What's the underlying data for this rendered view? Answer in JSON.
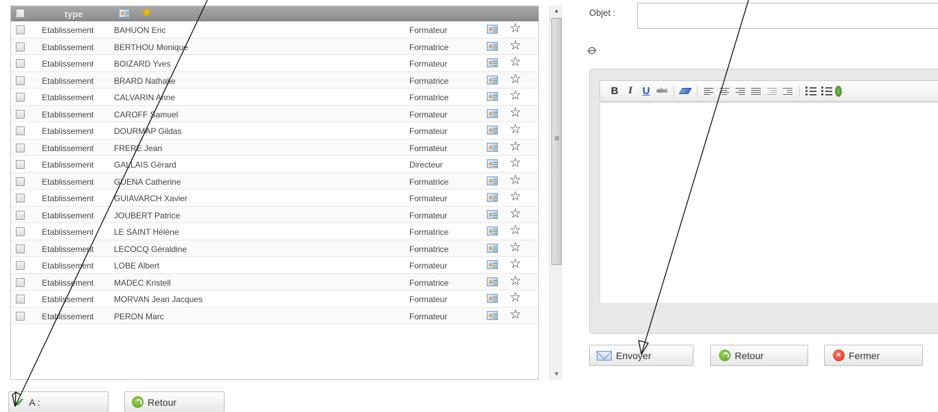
{
  "list": {
    "header_type": "type",
    "rows": [
      {
        "category": "Etablissement",
        "name": "BAHUON Eric",
        "role": "Formateur"
      },
      {
        "category": "Etablissement",
        "name": "BERTHOU Monique",
        "role": "Formatrice"
      },
      {
        "category": "Etablissement",
        "name": "BOIZARD Yves",
        "role": "Formateur"
      },
      {
        "category": "Etablissement",
        "name": "BRARD Nathalie",
        "role": "Formatrice"
      },
      {
        "category": "Etablissement",
        "name": "CALVARIN Anne",
        "role": "Formatrice"
      },
      {
        "category": "Etablissement",
        "name": "CAROFF Samuel",
        "role": "Formateur"
      },
      {
        "category": "Etablissement",
        "name": "DOURMAP Gildas",
        "role": "Formateur"
      },
      {
        "category": "Etablissement",
        "name": "FRERE Jean",
        "role": "Formateur"
      },
      {
        "category": "Etablissement",
        "name": "GALLAIS Gérard",
        "role": "Directeur"
      },
      {
        "category": "Etablissement",
        "name": "GUENA Catherine",
        "role": "Formatrice"
      },
      {
        "category": "Etablissement",
        "name": "GUIAVARCH Xavier",
        "role": "Formateur"
      },
      {
        "category": "Etablissement",
        "name": "JOUBERT Patrice",
        "role": "Formateur"
      },
      {
        "category": "Etablissement",
        "name": "LE SAINT Hélène",
        "role": "Formatrice"
      },
      {
        "category": "Etablissement",
        "name": "LECOCQ Géraldine",
        "role": "Formatrice"
      },
      {
        "category": "Etablissement",
        "name": "LOBE Albert",
        "role": "Formateur"
      },
      {
        "category": "Etablissement",
        "name": "MADEC Kristell",
        "role": "Formatrice"
      },
      {
        "category": "Etablissement",
        "name": "MORVAN Jean Jacques",
        "role": "Formateur"
      },
      {
        "category": "Etablissement",
        "name": "PERON Marc",
        "role": "Formateur"
      }
    ]
  },
  "left_buttons": {
    "a_label": "A :",
    "retour_label": "Retour"
  },
  "compose": {
    "objet_label": "Objet :",
    "objet_value": "",
    "toolbar": {
      "bold": "B",
      "italic": "I",
      "underline": "U",
      "strike": "abc"
    },
    "send_label": "Envoyer",
    "retour_label": "Retour",
    "close_label": "Fermer"
  },
  "colors": {
    "header_bg": "#999999",
    "favorite_star": "#f2b90c",
    "check_green": "#3da33d",
    "retour_green": "#4e9a18",
    "fermer_red": "#cf2a1a"
  }
}
